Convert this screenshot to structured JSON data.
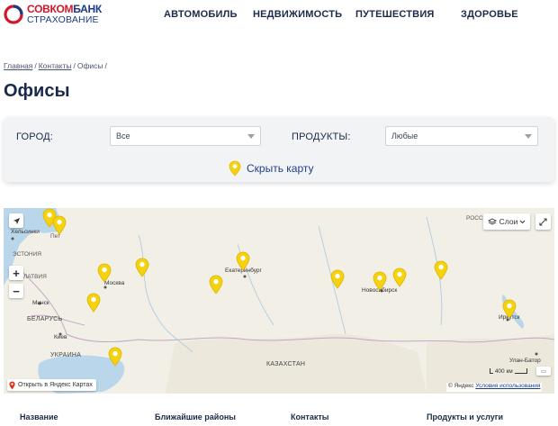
{
  "header": {
    "logo": {
      "line1_a": "СОВКОМ",
      "line1_b": "БАНК",
      "line2": "СТРАХОВАНИЕ"
    },
    "nav": [
      "АВТОМОБИЛЬ",
      "НЕДВИЖИМОСТЬ",
      "ПУТЕШЕСТВИЯ",
      "ЗДОРОВЬЕ"
    ]
  },
  "breadcrumb": [
    "Главная",
    "Контакты",
    "Офисы"
  ],
  "page_title": "Офисы",
  "filters": {
    "city_label": "ГОРОД:",
    "city_value": "Все",
    "products_label": "ПРОДУКТЫ:",
    "products_value": "Любые",
    "show_map": "Скрыть карту"
  },
  "map": {
    "labels": {
      "helsinki": "Хельсинки",
      "estonia": "ЭСТОНИЯ",
      "latvia": "ЛАТВИЯ",
      "moscow": "Москва",
      "minsk": "Минск",
      "belarus": "БЕЛАРУСЬ",
      "kiev": "Киев",
      "ukraine": "УКРАИНА",
      "yekaterinburg": "Екатеринбург",
      "novosibirsk": "Новосибирск",
      "kazakhstan": "КАЗАХСТАН",
      "irkutsk": "Иркутск",
      "ulan_bator": "Улан-Батор",
      "russia": "РОСС",
      "saint_petersburg": "Пет"
    },
    "layers_label": "Слои",
    "open_in_yandex": "Открыть в Яндекс Картах",
    "scale_label": "400 км",
    "copyright": "© Яндекс",
    "terms_link": "Условия использования",
    "pin_color": "#f6d20e"
  },
  "table_headers": [
    "Название",
    "Ближайшие районы",
    "Контакты",
    "Продукты и услуги"
  ],
  "colors": {
    "brand_red": "#d1172b",
    "brand_blue": "#1c3b87",
    "text_dark": "#1b2a4a",
    "link_blue": "#1e3f8f"
  }
}
